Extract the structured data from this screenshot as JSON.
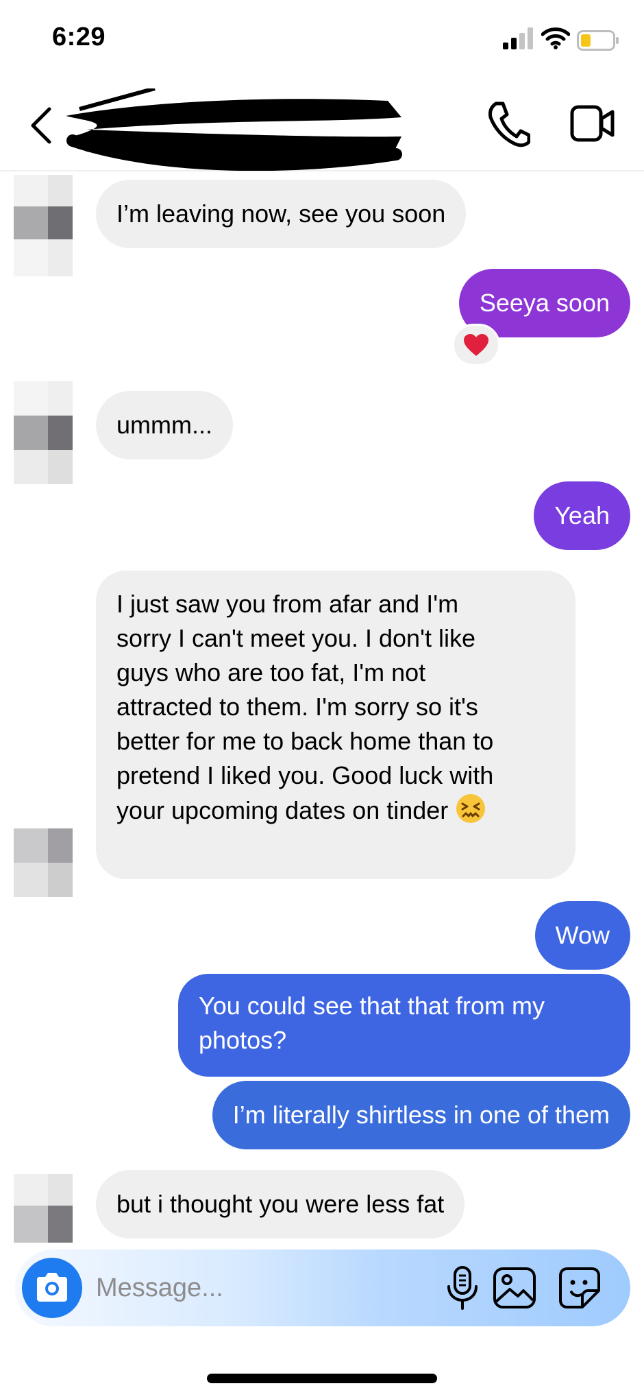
{
  "status_bar": {
    "time": "6:29",
    "icons": [
      "cellular-signal-icon",
      "wifi-icon",
      "battery-low-icon"
    ]
  },
  "header": {
    "contact_name": "",
    "icons": {
      "back": "chevron-left-icon",
      "call": "phone-icon",
      "video": "video-camera-icon"
    }
  },
  "messages": [
    {
      "sender": "them",
      "text": "I’m leaving now, see you soon"
    },
    {
      "sender": "me",
      "text": "Seeya soon",
      "reaction": "❤️"
    },
    {
      "sender": "them",
      "text": "ummm..."
    },
    {
      "sender": "me",
      "text": "Yeah"
    },
    {
      "sender": "them",
      "lines": [
        "I just saw you from afar and I'm",
        "sorry I can't meet you.  I don't like",
        "guys who are too fat, I'm not",
        "attracted to them.  I'm sorry so it's",
        "better for me to back home than to",
        "pretend I liked you.  Good luck with",
        "your upcoming dates on tinder"
      ],
      "trailing_emoji": "😖"
    },
    {
      "sender": "me",
      "text": "Wow"
    },
    {
      "sender": "me",
      "lines": [
        "You could see that  that from my",
        "photos?"
      ]
    },
    {
      "sender": "me",
      "text": "I’m literally shirtless in one of them"
    },
    {
      "sender": "them",
      "text": "but i thought you were less fat"
    }
  ],
  "composer": {
    "placeholder": "Message...",
    "icons": [
      "camera-icon",
      "microphone-icon",
      "gallery-icon",
      "sticker-icon"
    ]
  },
  "colors": {
    "incoming_bubble": "#efefef",
    "outgoing_purple": "#8e35d6",
    "outgoing_blue": "#3f66e2",
    "camera_button": "#1f7cf0"
  }
}
